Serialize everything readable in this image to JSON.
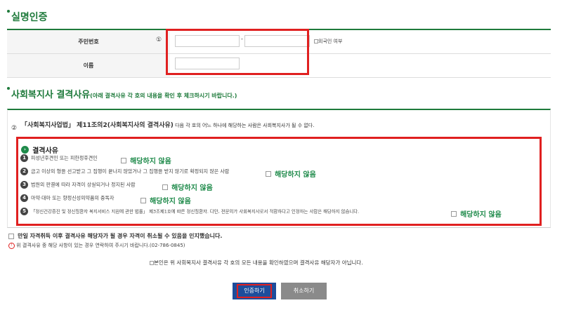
{
  "section1": {
    "title": "실명인증",
    "rrn_label": "주민번호",
    "circle_one": "①",
    "dash": "-",
    "foreigner_label": "외국인 여부",
    "name_label": "이름"
  },
  "section2": {
    "title_main": "사회복지사 결격사유",
    "title_sub": "(아래 결격사유 각 호의 내용을 확인 후 체크하시기 바랍니다.)",
    "circle_two": "②",
    "law_bold": "「사회복지사업법」 제11조의2(사회복지사의 결격사유)",
    "law_rest": " 다음 각 호의 어느 하나에 해당하는 사람은 사회복지사가 될 수 없다.",
    "disq_title": "결격사유",
    "items": [
      {
        "num": "1",
        "text": "피성년후견인 또는 피한정후견인",
        "check_label": "해당하지 않음"
      },
      {
        "num": "2",
        "text": "금고 이상의 형을 선고받고 그 집행이 끝나지 않았거나 그 집행을 받지 않기로 확정되지 않은 사람",
        "check_label": "해당하지 않음"
      },
      {
        "num": "3",
        "text": "법원의 판결에 따라 자격이 상실되거나 정지된 사람",
        "check_label": "해당하지 않음"
      },
      {
        "num": "4",
        "text": "마약·대마 또는 향정신성의약품의 중독자",
        "check_label": "해당하지 않음"
      },
      {
        "num": "5",
        "text": "「정신건강증진 및 정신질환자 복지서비스 지원에 관한 법률」 제3조제1호에 따른 정신질환자. 다만, 전문의가 사회복지사로서 적합하다고 인정하는 사람은 해당하지 않습니다.",
        "check_label": "해당하지 않음"
      }
    ],
    "cancel_notice": "만일 자격취득 이후 결격사유 해당자가 될 경우 자격이 취소될 수 있음을 인지했습니다.",
    "contact_icon": "!",
    "contact_notice": "위 결격사유 중 해당 사항이 있는 경우 연락하여 주시기 바랍니다.(02-786-0845)",
    "confirm_label": "본인은 위 사회복지사 결격사유 각 호의 모든 내용을 확인하였으며 결격사유 해당자가 아닙니다."
  },
  "buttons": {
    "verify": "인증하기",
    "cancel": "취소하기"
  },
  "colors": {
    "accent_green": "#1e7a3b",
    "highlight_red": "#e02020",
    "verify_blue": "#1e4d9b",
    "cancel_gray": "#8a8a8a"
  }
}
